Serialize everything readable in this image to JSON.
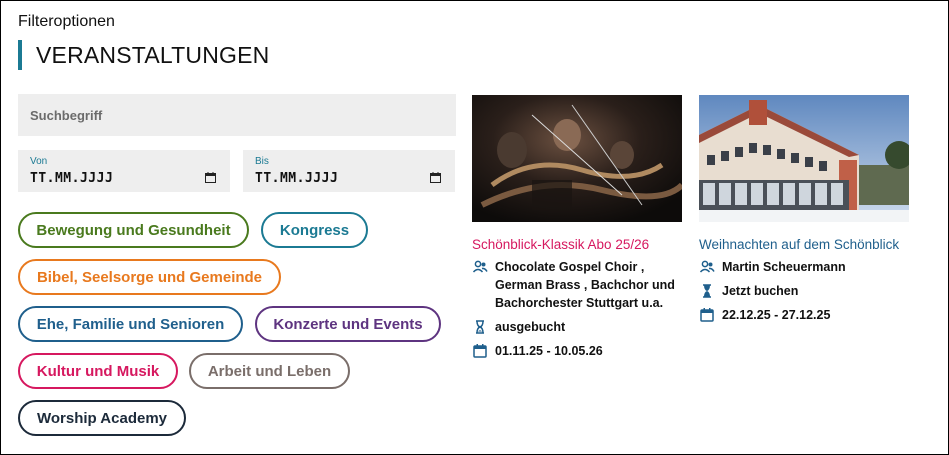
{
  "filter": {
    "title": "Filteroptionen"
  },
  "section": {
    "title": "VERANSTALTUNGEN"
  },
  "search": {
    "placeholder": "Suchbegriff"
  },
  "date_from": {
    "label": "Von",
    "value": "TT.MM.JJJJ"
  },
  "date_to": {
    "label": "Bis",
    "value": "TT.MM.JJJJ"
  },
  "categories": [
    {
      "label": "Bewegung und Gesundheit",
      "color": "#4a7a1e"
    },
    {
      "label": "Kongress",
      "color": "#1b7a93"
    },
    {
      "label": "Bibel, Seelsorge und Gemeinde",
      "color": "#e8791e"
    },
    {
      "label": "Ehe, Familie und Senioren",
      "color": "#1f5f8c"
    },
    {
      "label": "Konzerte und Events",
      "color": "#5e3480"
    },
    {
      "label": "Kultur und Musik",
      "color": "#d6185f"
    },
    {
      "label": "Arbeit und Leben",
      "color": "#7a6e6a"
    },
    {
      "label": "Worship Academy",
      "color": "#1c2a3a"
    }
  ],
  "events": [
    {
      "title": "Schönblick-Klassik Abo 25/26",
      "title_color": "#d6185f",
      "performers": "Chocolate Gospel Choir , German Brass , Bachchor und Bachorchester Stuttgart u.a.",
      "status": "ausgebucht",
      "dates": "01.11.25 - 10.05.26"
    },
    {
      "title": "Weihnachten auf dem Schönblick",
      "title_color": "#1f5f8c",
      "performers": "Martin Scheuermann",
      "status": "Jetzt buchen",
      "dates": "22.12.25 - 27.12.25"
    }
  ],
  "icons": {
    "people": "people-icon",
    "hourglass": "hourglass-icon",
    "calendar": "calendar-icon"
  },
  "accent_color": "#1b7a93"
}
